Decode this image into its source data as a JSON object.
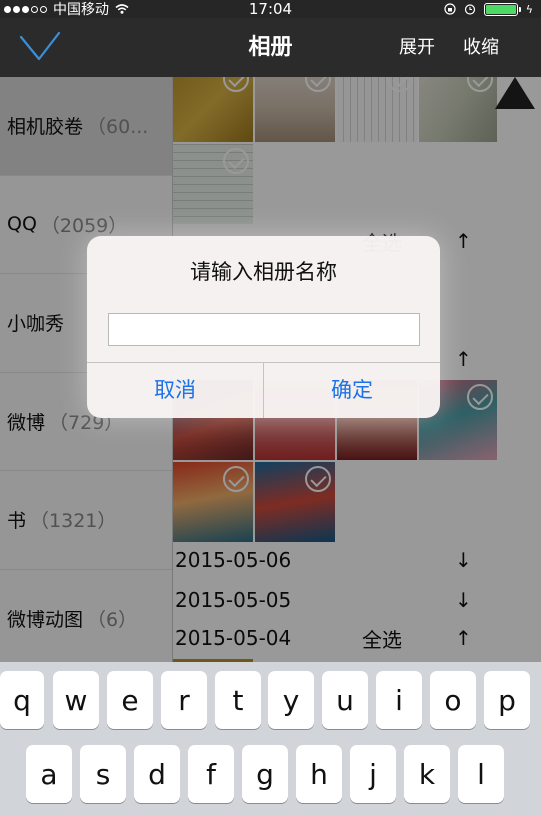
{
  "status_bar": {
    "carrier": "中国移动",
    "time": "17:04",
    "battery_level": 1.0,
    "battery_color": "#4cd964"
  },
  "nav": {
    "title": "相册",
    "expand": "展开",
    "collapse": "收缩",
    "check_icon": "checkmark-icon",
    "accent": "#3b8fd9"
  },
  "albums": [
    {
      "name": "相机胶卷",
      "count": "（60..."
    },
    {
      "name": "QQ",
      "count": "（2059）"
    },
    {
      "name": "小咖秀",
      "count": ""
    },
    {
      "name": "微博",
      "count": "（729）"
    },
    {
      "name": "书",
      "count": "（1321）"
    },
    {
      "name": "微博动图",
      "count": "（6）"
    }
  ],
  "content": {
    "date_rows": [
      {
        "date": "2015-05-06",
        "select": "",
        "arrow": "↓"
      },
      {
        "date": "2015-05-05",
        "select": "",
        "arrow": "↓"
      },
      {
        "date": "2015-05-04",
        "select": "全选",
        "arrow": "↑"
      }
    ],
    "partial_row_1": {
      "select": "全选",
      "arrow": "↑"
    },
    "partial_row_2": {
      "arrow": "↑"
    }
  },
  "alert": {
    "title": "请输入相册名称",
    "input_value": "",
    "cancel": "取消",
    "confirm": "确定"
  },
  "keyboard": {
    "row1": [
      "q",
      "w",
      "e",
      "r",
      "t",
      "y",
      "u",
      "i",
      "o",
      "p"
    ],
    "row2": [
      "a",
      "s",
      "d",
      "f",
      "g",
      "h",
      "j",
      "k",
      "l"
    ]
  }
}
